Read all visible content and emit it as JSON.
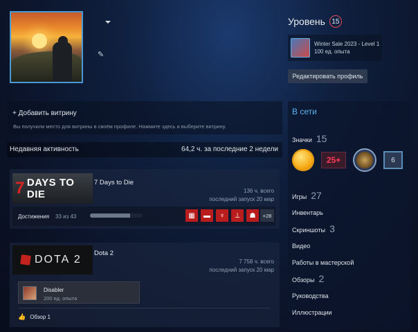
{
  "level": {
    "title": "Уровень",
    "value": "15"
  },
  "featured_badge": {
    "name": "Winter Sale 2023 - Level 1",
    "xp": "100 ед. опыта"
  },
  "edit_profile_label": "Редактировать профиль",
  "showcase": {
    "add_label": "+ Добавить витрину",
    "hint": "Вы получили место для витрины в своём профиле. Нажмите здесь и выберите витрину."
  },
  "recent": {
    "title": "Недавняя активность",
    "summary": "64,2 ч. за последние 2 недели"
  },
  "games": [
    {
      "logo_text": "DAYS TO DIE",
      "logo_number": "7",
      "name": "7 Days to Die",
      "hours": "136 ч. всего",
      "last_played": "последний запуск 20 мар",
      "achievements_label": "Достижения",
      "achievements_count": "33 из 43",
      "achievements_progress": 0.767,
      "more_achievements": "+28",
      "icons": [
        "grid-icon",
        "vehicle-icon",
        "trophy-icon",
        "weights-icon",
        "figure-icon"
      ]
    },
    {
      "logo_text": "DOTA 2",
      "name": "Dota 2",
      "hours": "7 758 ч. всего",
      "last_played": "последний запуск 20 мар",
      "badge_name": "Disabler",
      "badge_xp": "200 ед. опыта",
      "review_label": "Обзор 1"
    }
  ],
  "sidebar": {
    "status": "В сети",
    "badges_label": "Значки",
    "badges_count": "15",
    "badge_25_text": "25+",
    "badge_six_text": "6",
    "games_label": "Игры",
    "games_count": "27",
    "inventory": "Инвентарь",
    "screenshots_label": "Скриншоты",
    "screenshots_count": "3",
    "videos": "Видео",
    "workshop": "Работы в мастерской",
    "reviews_label": "Обзоры",
    "reviews_count": "2",
    "guides": "Руководства",
    "artwork": "Иллюстрации"
  }
}
